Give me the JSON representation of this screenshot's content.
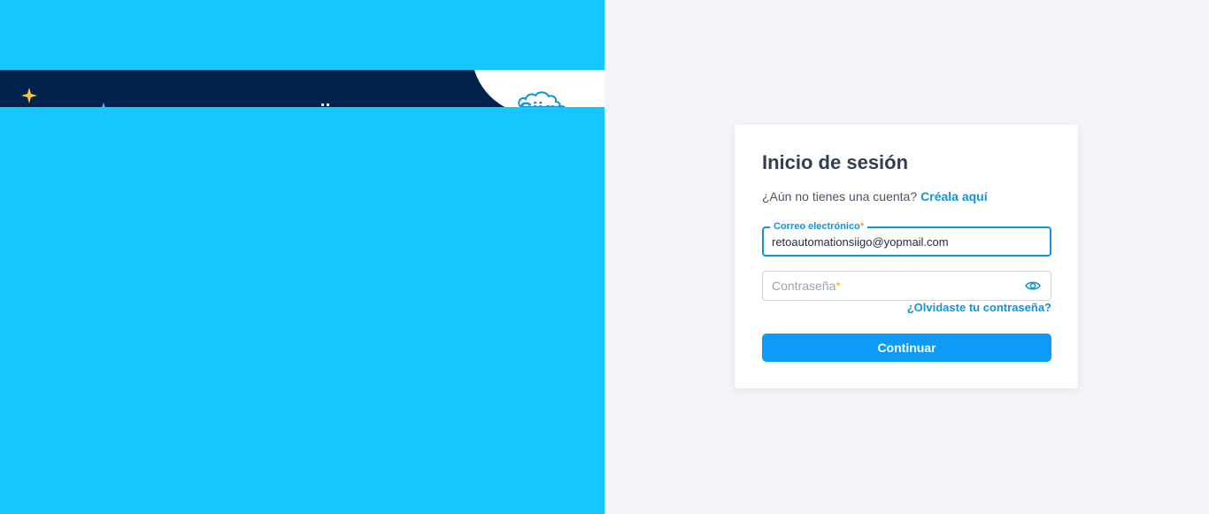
{
  "brand": {
    "logo_text": "Siigo",
    "logo_color": "#1193de",
    "accent_color": "#0c9cf7",
    "left_bg": "#16c6ff",
    "banner_bg": "#00224d"
  },
  "login": {
    "title": "Inicio de sesión",
    "signup_prompt": "¿Aún no tienes una cuenta?",
    "signup_link": "Créala aquí",
    "email_label": "Correo electrónico",
    "required_mark": "*",
    "email_value": "retoautomationsiigo@yopmail.com",
    "password_label": "Contraseña",
    "password_value": "",
    "password_toggle_icon": "eye-icon",
    "forgot_link": "¿Olvidaste tu contraseña?",
    "continue_label": "Continuar"
  }
}
